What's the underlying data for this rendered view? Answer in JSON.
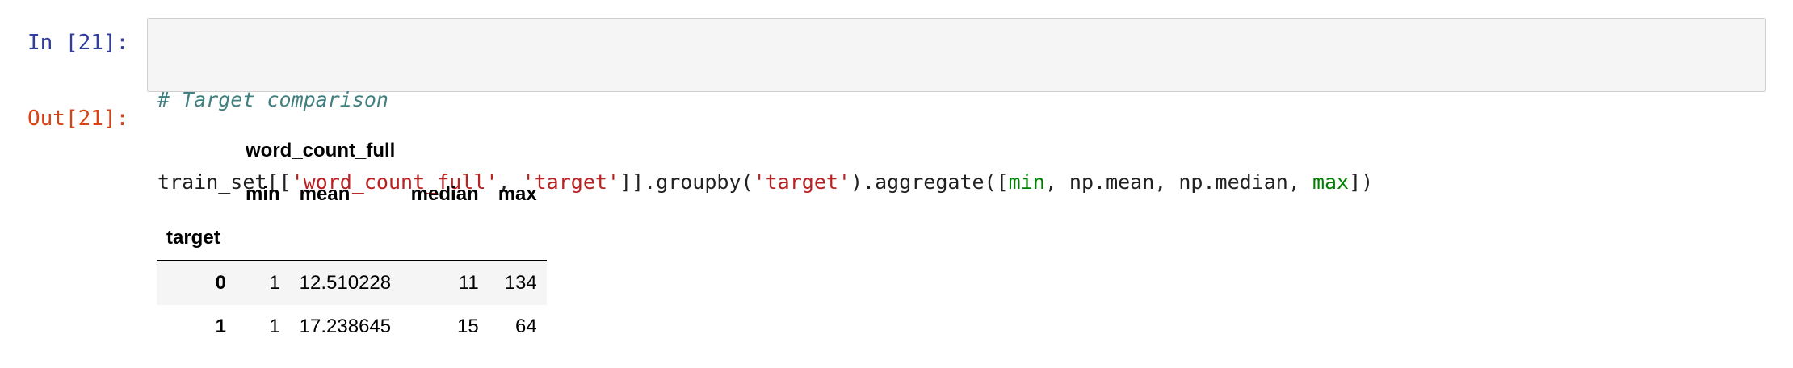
{
  "cell": {
    "in_prompt": "In [21]:",
    "out_prompt": "Out[21]:",
    "code": {
      "comment": "# Target comparison",
      "t1": "train_set[[",
      "s1": "'word_count_full'",
      "t2": ", ",
      "s2": "'target'",
      "t3": "]].groupby(",
      "s3": "'target'",
      "t4": ").aggregate([",
      "b1": "min",
      "t5": ", np.mean, np.median, ",
      "b2": "max",
      "t6": "])"
    }
  },
  "dataframe": {
    "column_group": "word_count_full",
    "columns": [
      "min",
      "mean",
      "median",
      "max"
    ],
    "index_name": "target",
    "rows": [
      {
        "index": "0",
        "min": "1",
        "mean": "12.510228",
        "median": "11",
        "max": "134"
      },
      {
        "index": "1",
        "min": "1",
        "mean": "17.238645",
        "median": "15",
        "max": "64"
      }
    ]
  },
  "colors": {
    "in_prompt": "#303f9f",
    "out_prompt": "#d84315",
    "comment": "#408080",
    "string": "#ba2121",
    "builtin": "#008000",
    "cell_background": "#f5f5f5"
  }
}
